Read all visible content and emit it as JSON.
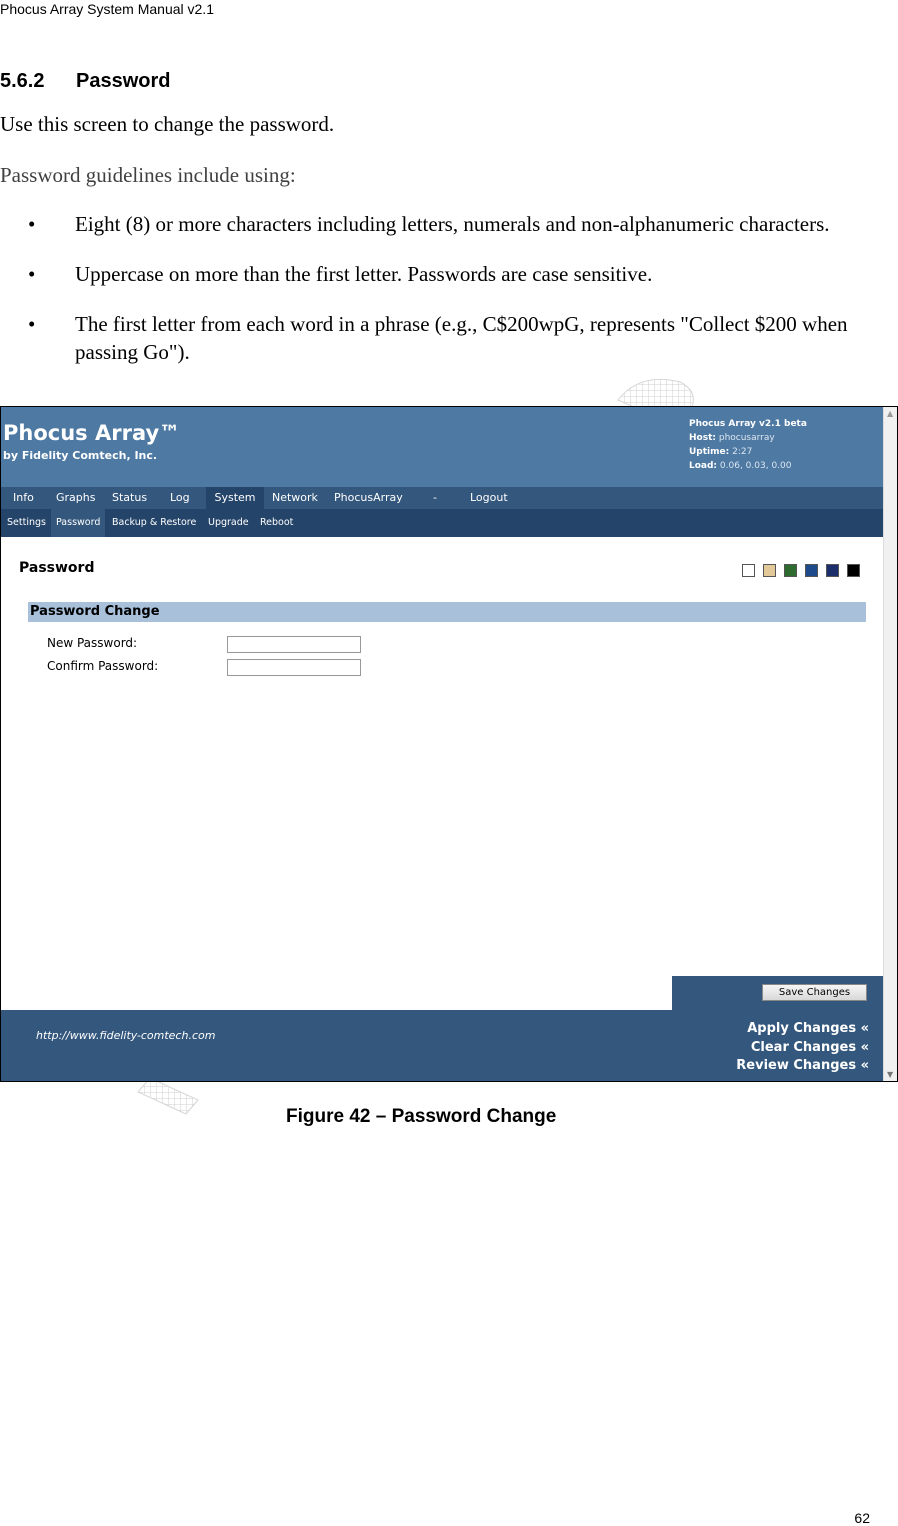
{
  "document": {
    "running_header": "Phocus Array System Manual v2.1",
    "section_number": "5.6.2",
    "section_title": "Password",
    "intro": "Use this screen to change the password.",
    "guidelines_lead": "Password guidelines include using:",
    "bullets": [
      "Eight (8) or more characters including letters, numerals and non-alphanumeric characters.",
      "Uppercase on more than the first letter. Passwords are case sensitive.",
      "The first letter from each word in a phrase (e.g., C$200wpG, represents \"Collect $200 when passing Go\")."
    ],
    "bullet_glyph": "•",
    "caption": "Figure 42 – Password Change",
    "page_number": "62"
  },
  "app": {
    "title": "Phocus Array™",
    "subtitle": "by Fidelity Comtech, Inc.",
    "info": {
      "version": "Phocus Array v2.1 beta",
      "host_label": "Host:",
      "host_value": "phocusarray",
      "uptime_label": "Uptime:",
      "uptime_value": "2:27",
      "load_label": "Load:",
      "load_value": "0.06, 0.03, 0.00"
    },
    "nav": [
      "Info",
      "Graphs",
      "Status",
      "Log",
      "System",
      "Network",
      "PhocusArray",
      "-",
      "Logout"
    ],
    "nav_active": "System",
    "subnav": [
      "Settings",
      "Password",
      "Backup & Restore",
      "Upgrade",
      "Reboot"
    ],
    "subnav_active": "Password",
    "page_title": "Password",
    "theme_colors": [
      "#ffffff",
      "#e3c99a",
      "#2e6b2e",
      "#1c4a8a",
      "#1c2d6b",
      "#000000"
    ],
    "panel_title": "Password Change",
    "fields": {
      "new_password_label": "New Password:",
      "new_password_value": "",
      "confirm_password_label": "Confirm Password:",
      "confirm_password_value": ""
    },
    "save_label": "Save Changes",
    "footer_url": "http://www.fidelity-comtech.com",
    "footer_links": [
      "Apply Changes «",
      "Clear Changes «",
      "Review Changes «"
    ],
    "colors": {
      "header_bg": "#4e79a3",
      "nav_bg": "#34577d",
      "subnav_bg": "#25446a",
      "panel_bg": "#a8c0da"
    }
  }
}
